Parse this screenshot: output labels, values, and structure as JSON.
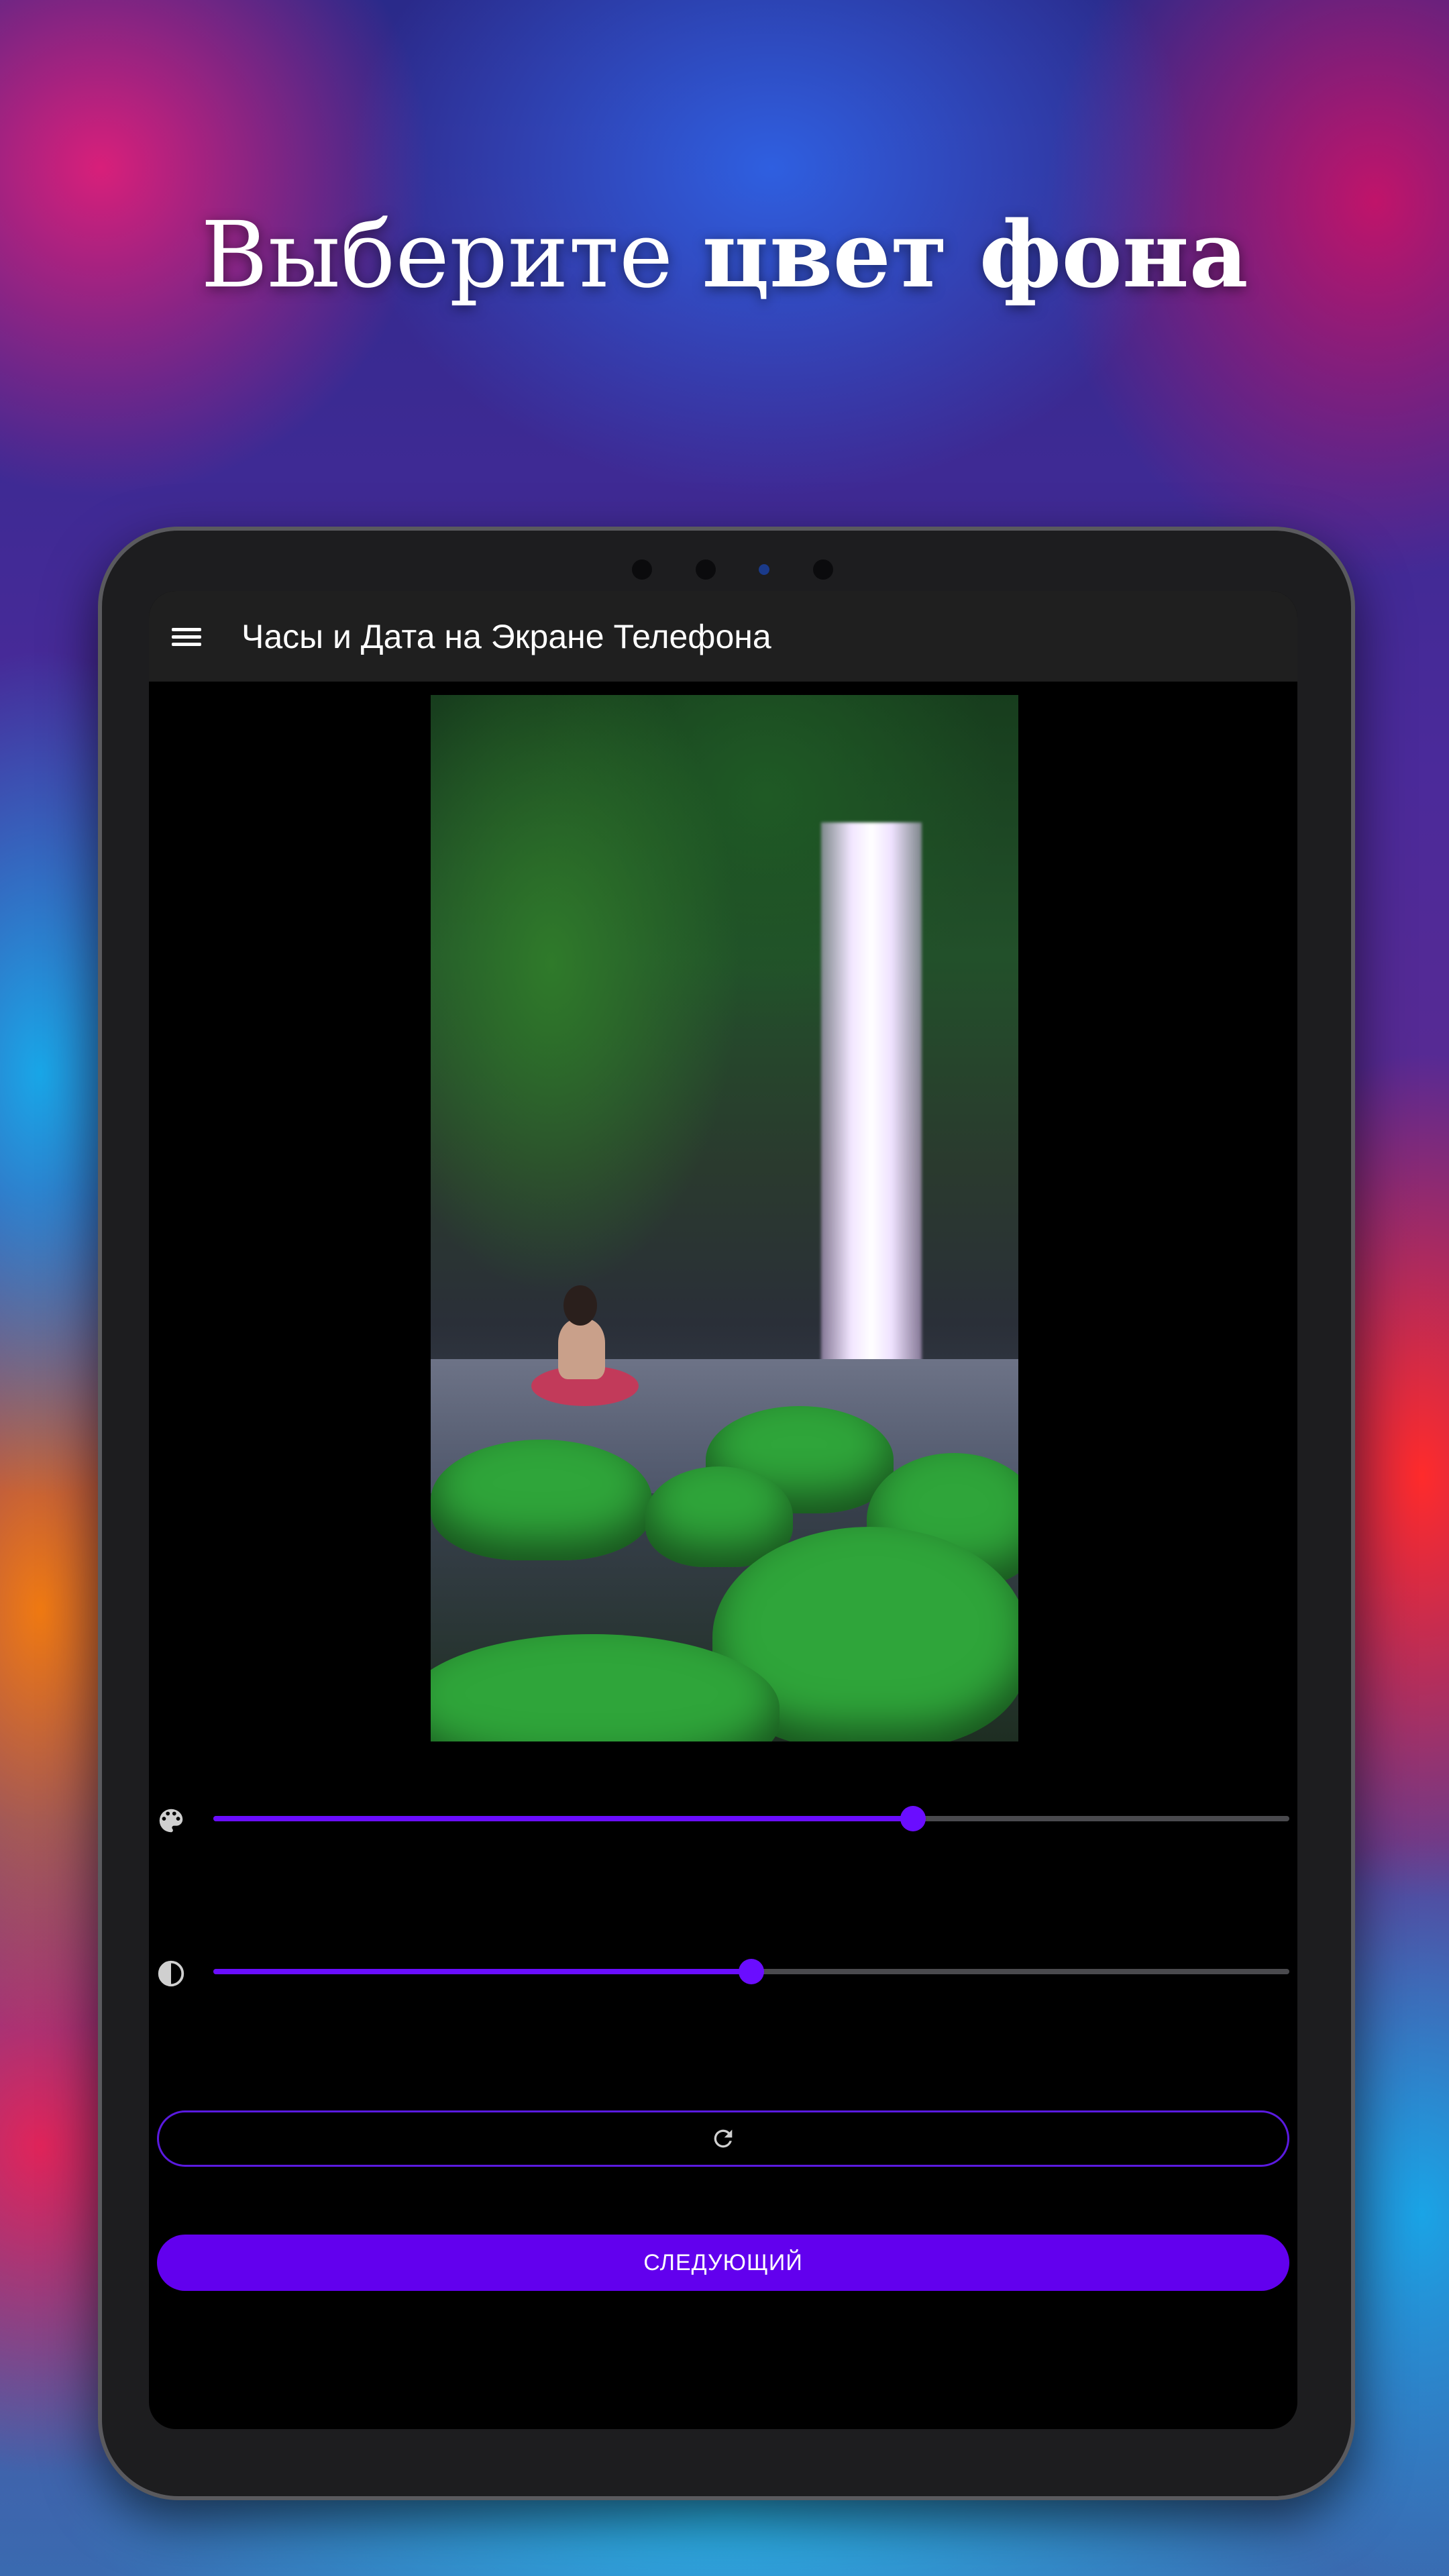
{
  "promo": {
    "headline_regular": "Выберите ",
    "headline_bold": "цвет фона"
  },
  "app": {
    "title": "Часы и Дата на Экране Телефона",
    "menu_icon": "hamburger-menu-icon"
  },
  "controls": {
    "hue_slider": {
      "icon": "palette-icon",
      "value": 0.65
    },
    "brightness_slider": {
      "icon": "contrast-icon",
      "value": 0.5
    },
    "reset_button": {
      "icon": "refresh-icon"
    },
    "next_button": {
      "label": "СЛЕДУЮЩИЙ"
    }
  },
  "colors": {
    "accent": "#6200EE",
    "screen_background": "#000000",
    "appbar_background": "#1F1F1F"
  }
}
